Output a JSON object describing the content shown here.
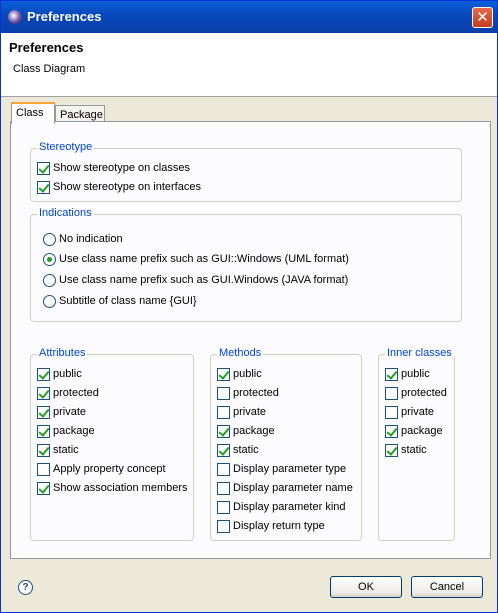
{
  "window": {
    "title": "Preferences",
    "close_label": "✕"
  },
  "header": {
    "title": "Preferences",
    "subtitle": "Class Diagram"
  },
  "tabs": [
    {
      "label": "Class",
      "active": true
    },
    {
      "label": "Package",
      "active": false
    }
  ],
  "stereotype": {
    "legend": "Stereotype",
    "items": [
      {
        "label": "Show stereotype on classes",
        "checked": true
      },
      {
        "label": "Show stereotype on interfaces",
        "checked": true
      }
    ]
  },
  "indications": {
    "legend": "Indications",
    "options": [
      {
        "label": "No indication",
        "selected": false
      },
      {
        "label": "Use class name prefix such as GUI::Windows (UML format)",
        "selected": true
      },
      {
        "label": "Use class name prefix such as GUI.Windows (JAVA format)",
        "selected": false
      },
      {
        "label": "Subtitle of class name {GUI}",
        "selected": false
      }
    ]
  },
  "attributes": {
    "legend": "Attributes",
    "items": [
      {
        "label": "public",
        "checked": true
      },
      {
        "label": "protected",
        "checked": true
      },
      {
        "label": "private",
        "checked": true
      },
      {
        "label": "package",
        "checked": true
      },
      {
        "label": "static",
        "checked": true
      },
      {
        "label": "Apply property concept",
        "checked": false
      },
      {
        "label": "Show association members",
        "checked": true
      }
    ]
  },
  "methods": {
    "legend": "Methods",
    "items": [
      {
        "label": "public",
        "checked": true
      },
      {
        "label": "protected",
        "checked": false
      },
      {
        "label": "private",
        "checked": false
      },
      {
        "label": "package",
        "checked": true
      },
      {
        "label": "static",
        "checked": true
      },
      {
        "label": "Display parameter type",
        "checked": false
      },
      {
        "label": "Display parameter name",
        "checked": false
      },
      {
        "label": "Display parameter kind",
        "checked": false
      },
      {
        "label": "Display return type",
        "checked": false
      }
    ]
  },
  "inner_classes": {
    "legend": "Inner classes",
    "items": [
      {
        "label": "public",
        "checked": true
      },
      {
        "label": "protected",
        "checked": false
      },
      {
        "label": "private",
        "checked": false
      },
      {
        "label": "package",
        "checked": true
      },
      {
        "label": "static",
        "checked": true
      }
    ]
  },
  "footer": {
    "help_icon": "help-icon",
    "help_glyph": "?",
    "ok_label": "OK",
    "cancel_label": "Cancel"
  }
}
